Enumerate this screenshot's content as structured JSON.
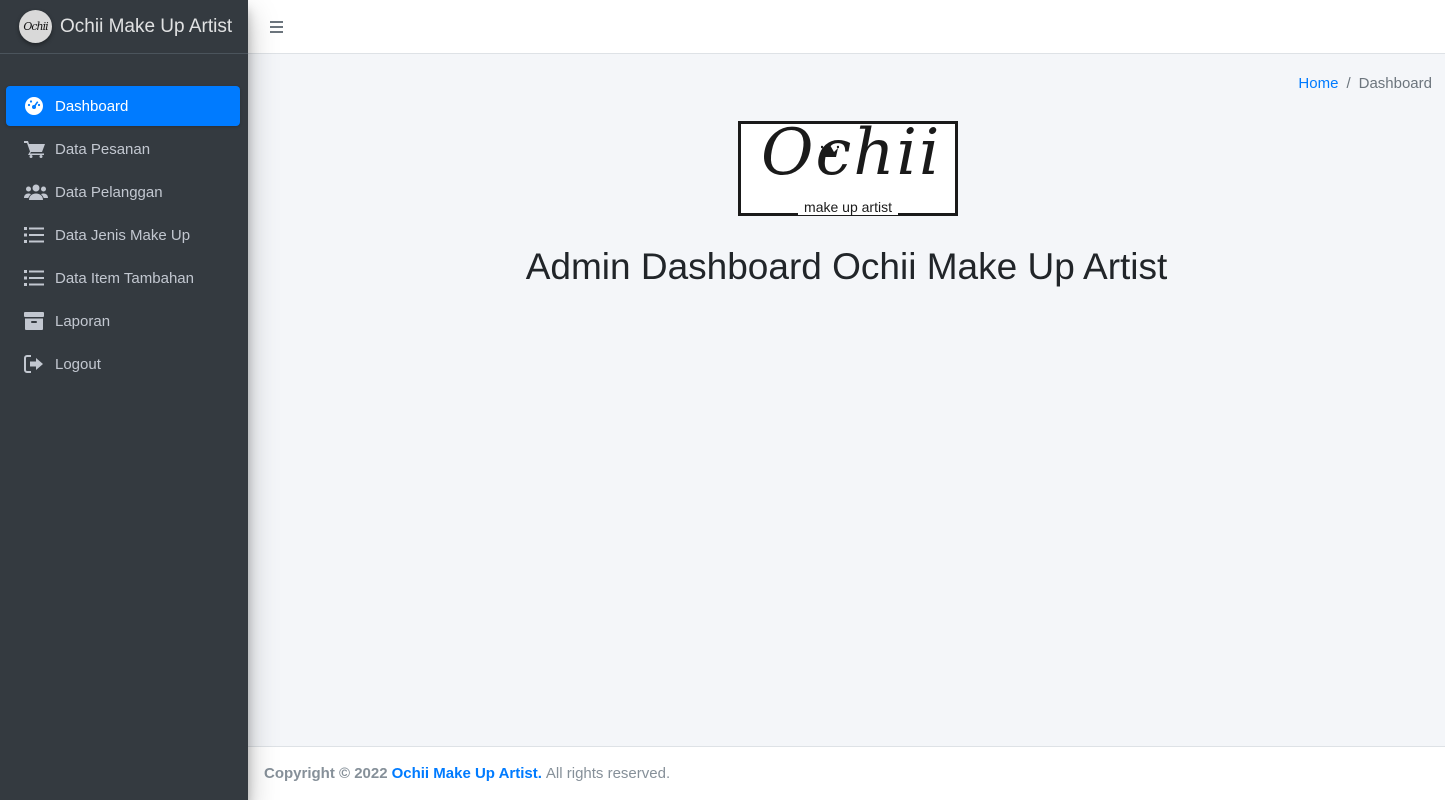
{
  "brand": {
    "logo_text": "Ochii",
    "title": "Ochii Make Up Artist"
  },
  "sidebar": {
    "items": [
      {
        "label": "Dashboard",
        "icon": "tachometer-icon",
        "active": true
      },
      {
        "label": "Data Pesanan",
        "icon": "shopping-cart-icon",
        "active": false
      },
      {
        "label": "Data Pelanggan",
        "icon": "users-icon",
        "active": false
      },
      {
        "label": "Data Jenis Make Up",
        "icon": "list-icon",
        "active": false
      },
      {
        "label": "Data Item Tambahan",
        "icon": "list-icon",
        "active": false
      },
      {
        "label": "Laporan",
        "icon": "archive-icon",
        "active": false
      },
      {
        "label": "Logout",
        "icon": "sign-out-icon",
        "active": false
      }
    ]
  },
  "header": {
    "menu_icon": "hamburger-icon"
  },
  "breadcrumb": {
    "home": "Home",
    "separator": "/",
    "current": "Dashboard"
  },
  "main": {
    "logo": {
      "script": "Ochii",
      "subtitle": "make up artist"
    },
    "title": "Admin Dashboard Ochii Make Up Artist"
  },
  "footer": {
    "copyright": "Copyright © 2022",
    "link": "Ochii Make Up Artist.",
    "rights": "All rights reserved."
  },
  "colors": {
    "sidebar_bg": "#343a40",
    "accent": "#007bff",
    "content_bg": "#f4f6f9"
  }
}
